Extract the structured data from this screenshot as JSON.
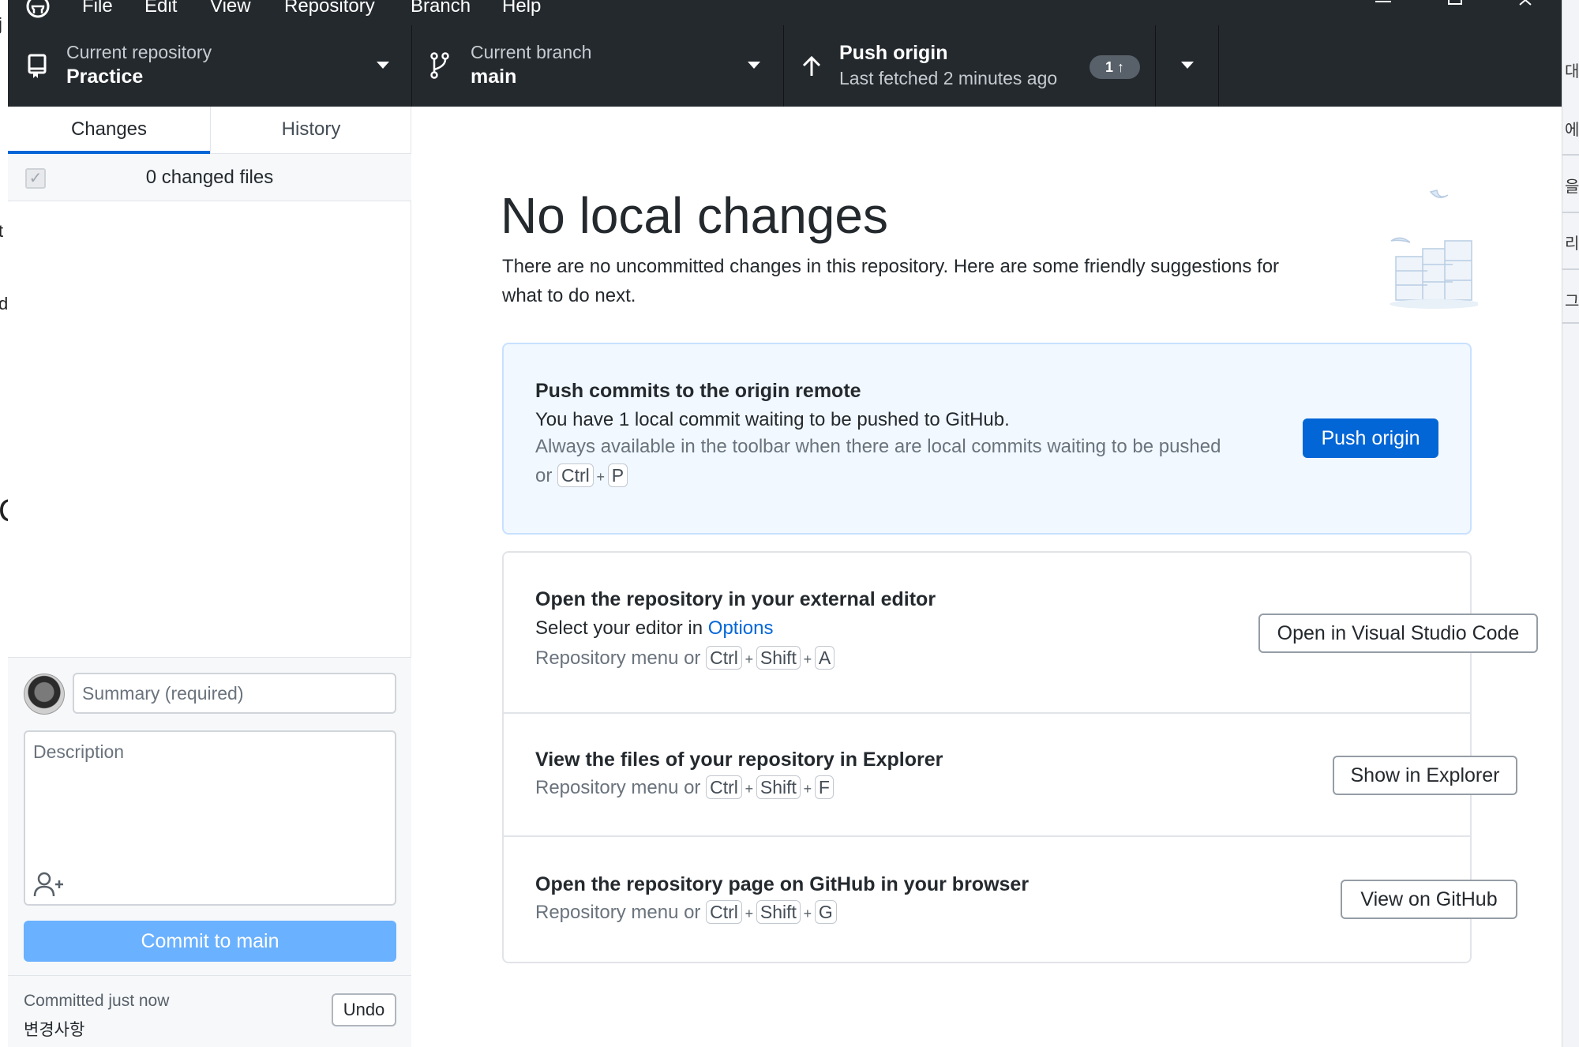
{
  "menu": [
    "File",
    "Edit",
    "View",
    "Repository",
    "Branch",
    "Help"
  ],
  "toolbar": {
    "repo_label": "Current repository",
    "repo_name": "Practice",
    "branch_label": "Current branch",
    "branch_name": "main",
    "push_title": "Push origin",
    "push_subtitle": "Last fetched 2 minutes ago",
    "ahead_count": "1 ↑"
  },
  "sidebar": {
    "tabs": [
      "Changes",
      "History"
    ],
    "changed_files": "0 changed files",
    "summary_placeholder": "Summary (required)",
    "description_placeholder": "Description",
    "commit_label": "Commit to main",
    "last_commit_time": "Committed just now",
    "last_commit_message": "변경사항",
    "undo_label": "Undo"
  },
  "main": {
    "title": "No local changes",
    "description": "There are no uncommitted changes in this repository. Here are some friendly suggestions for what to do next.",
    "push_card": {
      "title": "Push commits to the origin remote",
      "subtitle": "You have 1 local commit waiting to be pushed to GitHub.",
      "hint": "Always available in the toolbar when there are local commits waiting to be pushed",
      "hint_or": "or",
      "keys": [
        "Ctrl",
        "P"
      ],
      "button": "Push origin"
    },
    "editor_card": {
      "title": "Open the repository in your external editor",
      "subtitle_prefix": "Select your editor in",
      "subtitle_link": "Options",
      "hint": "Repository menu or",
      "keys": [
        "Ctrl",
        "Shift",
        "A"
      ],
      "button": "Open in Visual Studio Code"
    },
    "explorer_card": {
      "title": "View the files of your repository in Explorer",
      "hint": "Repository menu or",
      "keys": [
        "Ctrl",
        "Shift",
        "F"
      ],
      "button": "Show in Explorer"
    },
    "github_card": {
      "title": "Open the repository page on GitHub in your browser",
      "hint": "Repository menu or",
      "keys": [
        "Ctrl",
        "Shift",
        "G"
      ],
      "button": "View on GitHub"
    }
  },
  "background_fragments": {
    "left": [
      "j",
      "t",
      "d",
      "C"
    ],
    "right": [
      "대",
      "에",
      "을",
      "리",
      "그"
    ]
  },
  "colors": {
    "toolbar_bg": "#24292e",
    "accent": "#0366d6",
    "commit_button_disabled": "#6ab1ff",
    "push_card_bg": "#f1f8ff"
  }
}
